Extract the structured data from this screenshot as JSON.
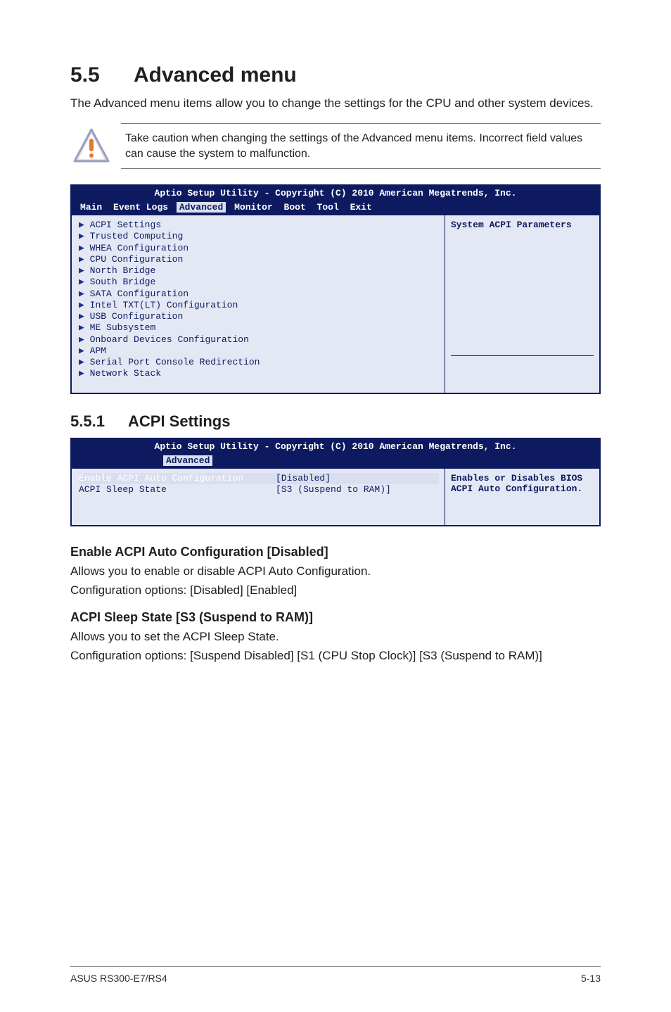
{
  "section": {
    "number": "5.5",
    "title": "Advanced menu",
    "intro": "The Advanced menu items allow you to change the settings for the CPU and other system devices."
  },
  "caution": {
    "text": "Take caution when changing the settings of the Advanced menu items. Incorrect field values can cause the system to malfunction."
  },
  "bios1": {
    "title": "Aptio Setup Utility - Copyright (C) 2010 American Megatrends, Inc.",
    "tabs": {
      "main": "Main",
      "event_logs": "Event Logs",
      "advanced": "Advanced",
      "monitor": "Monitor",
      "boot": "Boot",
      "tool": "Tool",
      "exit": "Exit"
    },
    "items": [
      "ACPI Settings",
      "Trusted Computing",
      "WHEA Configuration",
      "CPU Configuration",
      "North Bridge",
      "South Bridge",
      "SATA Configuration",
      "Intel TXT(LT) Configuration",
      "USB Configuration",
      "ME Subsystem",
      "Onboard Devices Configuration",
      "APM",
      "Serial Port Console Redirection",
      "Network Stack"
    ],
    "help": "System ACPI Parameters"
  },
  "subsection": {
    "number": "5.5.1",
    "title": "ACPI Settings"
  },
  "bios2": {
    "title": "Aptio Setup Utility - Copyright (C) 2010 American Megatrends, Inc.",
    "tab_active": "Advanced",
    "row1_label": "Enable ACPI Auto Configuration",
    "row1_value": "[Disabled]",
    "row2_label": "ACPI Sleep State",
    "row2_value": "[S3 (Suspend to RAM)]",
    "help": "Enables or Disables BIOS ACPI Auto Configuration."
  },
  "opt1": {
    "title": "Enable ACPI Auto Configuration [Disabled]",
    "line1": "Allows you to enable or disable ACPI Auto Configuration.",
    "line2": "Configuration options: [Disabled] [Enabled]"
  },
  "opt2": {
    "title": "ACPI Sleep State [S3 (Suspend to RAM)]",
    "line1": "Allows you to set the ACPI Sleep State.",
    "line2": "Configuration options: [Suspend Disabled] [S1 (CPU Stop Clock)] [S3 (Suspend to RAM)]"
  },
  "footer": {
    "product": "ASUS RS300-E7/RS4",
    "page": "5-13"
  }
}
